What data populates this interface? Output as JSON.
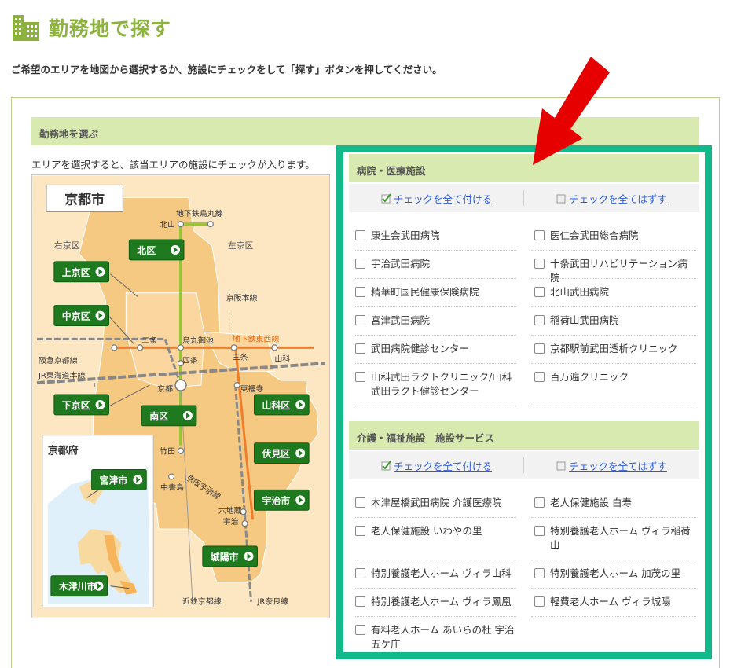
{
  "page": {
    "title": "勤務地で探す",
    "intro": "ご希望のエリアを地図から選択するか、施設にチェックをして「探す」ボタンを押してください。"
  },
  "section": {
    "title": "勤務地を選ぶ",
    "area_note": "エリアを選択すると、該当エリアの施設にチェックが入ります。"
  },
  "map": {
    "city_label": "京都市",
    "pref_label": "京都府",
    "area_buttons": [
      "北区",
      "上京区",
      "中京区",
      "下京区",
      "南区",
      "山科区",
      "伏見区",
      "宇治市",
      "城陽市",
      "宮津市",
      "木津川市"
    ],
    "region_labels": [
      "右京区",
      "左京区"
    ],
    "line_labels": {
      "karasuma": "地下鉄烏丸線",
      "keihan_honsen": "京阪本線",
      "tozai": "地下鉄東西線",
      "hankyu": "阪急京都線",
      "jr_tokaido": "JR東海道本線",
      "keihan_uji": "京阪宇治線",
      "kintetsu": "近鉄京都線",
      "jr_nara": "JR奈良線"
    },
    "station_labels": {
      "kitayama": "北山",
      "nijo": "二条",
      "karasuma_oike": "烏丸御池",
      "sanjo": "三条",
      "shijo": "四条",
      "yamashina": "山科",
      "kyoto": "京都",
      "tofukuji": "東福寺",
      "takeda": "竹田",
      "chushojima": "中書島",
      "rokujizo": "六地蔵",
      "uji": "宇治"
    }
  },
  "hospitals": {
    "header": "病院・医療施設",
    "check_all": "チェックを全て付ける",
    "uncheck_all": "チェックを全てはずす",
    "items": [
      "康生会武田病院",
      "医仁会武田総合病院",
      "宇治武田病院",
      "十条武田リハビリテーション病院",
      "精華町国民健康保険病院",
      "北山武田病院",
      "宮津武田病院",
      "稲荷山武田病院",
      "武田病院健診センター",
      "京都駅前武田透析クリニック",
      "山科武田ラクトクリニック/山科武田ラクト健診センター",
      "百万遍クリニック"
    ]
  },
  "care": {
    "header": "介護・福祉施設　施設サービス",
    "check_all": "チェックを全て付ける",
    "uncheck_all": "チェックを全てはずす",
    "items": [
      "木津屋橋武田病院 介護医療院",
      "老人保健施設 白寿",
      "老人保健施設 いわやの里",
      "特別養護老人ホーム ヴィラ稲荷山",
      "特別養護老人ホーム ヴィラ山科",
      "特別養護老人ホーム 加茂の里",
      "特別養護老人ホーム ヴィラ鳳凰",
      "軽費老人ホーム ヴィラ城陽",
      "有料老人ホーム あいらの杜 宇治五ケ庄"
    ]
  },
  "colors": {
    "title_green": "#8cb43c",
    "bar_green": "#d9eab0",
    "panel_border": "#13b98a",
    "button_green": "#1f7a1f",
    "map_orange": "#f6c983",
    "arrow_red": "#e60000",
    "link_blue": "#2a5bd7"
  }
}
